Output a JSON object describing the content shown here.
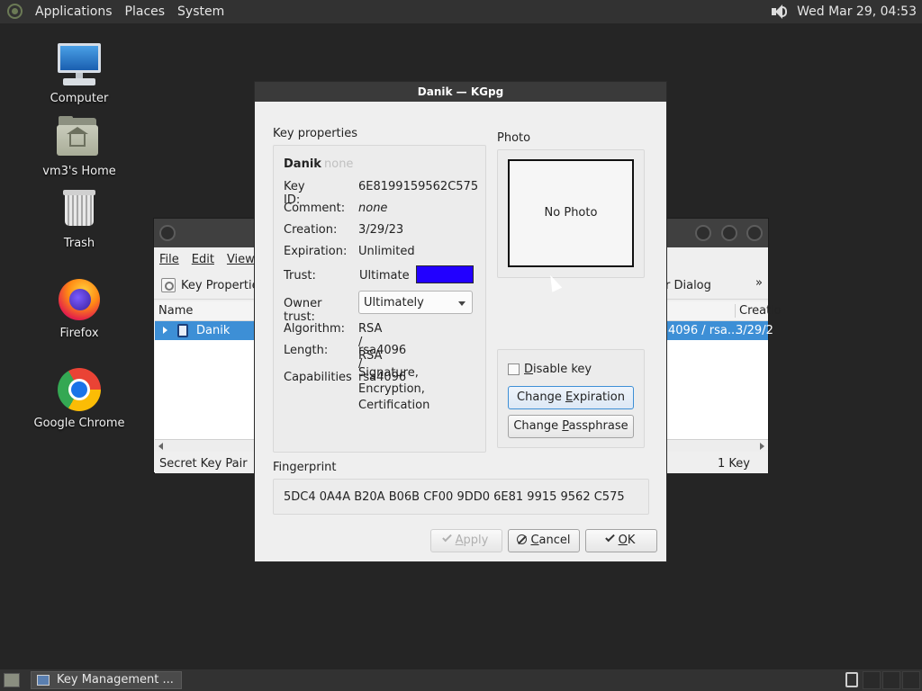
{
  "top_panel": {
    "menus": [
      "Applications",
      "Places",
      "System"
    ],
    "clock": "Wed Mar 29, 04:53"
  },
  "desktop_icons": [
    {
      "label": "Computer",
      "icon": "computer-icon"
    },
    {
      "label": "vm3's Home",
      "icon": "home-folder-icon"
    },
    {
      "label": "Trash",
      "icon": "trash-icon"
    },
    {
      "label": "Firefox",
      "icon": "firefox-icon"
    },
    {
      "label": "Google Chrome",
      "icon": "chrome-icon"
    }
  ],
  "bg_window": {
    "menus": [
      "File",
      "Edit",
      "View"
    ],
    "toolbar": {
      "key_properties": "Key Properties",
      "dialog": "er Dialog",
      "more": "»"
    },
    "columns": {
      "name": "Name",
      "creation": "Creatio"
    },
    "row": {
      "name": "Danik",
      "length": "4096 / rsa...",
      "creation": "3/29/2"
    },
    "status": {
      "left": "Secret Key Pair",
      "right": "1 Key"
    }
  },
  "dialog": {
    "title": "Danik — KGpg",
    "key_properties_label": "Key properties",
    "owner_name": "Danik",
    "owner_email": "none",
    "props": {
      "key_id_label": "Key ID:",
      "key_id": "6E8199159562C575",
      "comment_label": "Comment:",
      "comment": "none",
      "creation_label": "Creation:",
      "creation": "3/29/23",
      "expiration_label": "Expiration:",
      "expiration": "Unlimited",
      "trust_label": "Trust:",
      "trust": "Ultimate",
      "trust_color": "#2200ff",
      "owner_trust_label": "Owner trust:",
      "owner_trust": "Ultimately",
      "algorithm_label": "Algorithm:",
      "algorithm": "RSA / RSA",
      "length_label": "Length:",
      "length": "rsa4096 / rsa4096",
      "capabilities_label": "Capabilities",
      "capabilities": [
        "Signature,",
        "Encryption,",
        "Certification"
      ]
    },
    "photo_label": "Photo",
    "no_photo": "No Photo",
    "disable_key_label": "Disable key",
    "disable_key_checked": false,
    "change_expiration": "Change Expiration",
    "change_passphrase": "Change Passphrase",
    "fingerprint_label": "Fingerprint",
    "fingerprint": "5DC4 0A4A B20A B06B CF00 9DD0 6E81 9915 9562 C575",
    "buttons": {
      "apply": "Apply",
      "cancel": "Cancel",
      "ok": "OK"
    }
  },
  "taskbar": {
    "task": "Key Management ..."
  }
}
